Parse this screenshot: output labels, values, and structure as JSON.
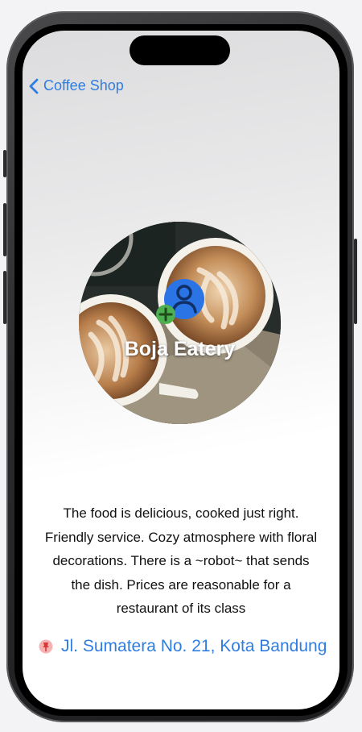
{
  "nav": {
    "back_label": "Coffee Shop",
    "back_icon": "chevron-left-icon"
  },
  "hero": {
    "title": "Boja Eatery",
    "badge_icon": "add-person-icon"
  },
  "description": "The food is delicious, cooked just right.\nFriendly service.  Cozy atmosphere with floral\ndecorations.  There is a ~robot~ that sends\nthe dish.  Prices are reasonable for a\nrestaurant of its class",
  "address": {
    "text": "Jl. Sumatera No. 21, Kota Bandung",
    "icon": "pushpin-icon"
  },
  "colors": {
    "accent": "#2f7de1",
    "add_badge": "#4caf50",
    "profile_icon": "#2a74e6"
  }
}
